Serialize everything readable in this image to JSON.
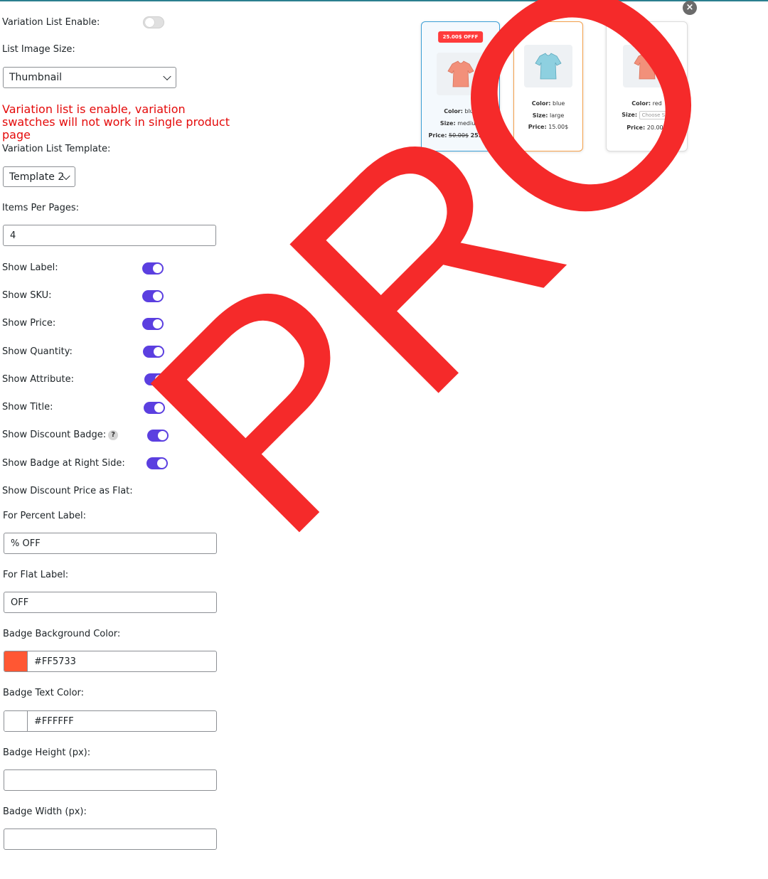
{
  "settings": {
    "variation_list_enable": "Variation List Enable:",
    "list_image_size": "List Image Size:",
    "list_image_size_value": "Thumbnail",
    "warning": "Variation list is enable, variation swatches will not work in single product page",
    "variation_list_template": "Variation List Template:",
    "template_value": "Template 2",
    "items_per_pages": "Items Per Pages:",
    "items_per_pages_value": "4",
    "show_label": "Show Label:",
    "show_sku": "Show SKU:",
    "show_price": "Show Price:",
    "show_quantity": "Show Quantity:",
    "show_attribute": "Show Attribute:",
    "show_title": "Show Title:",
    "show_discount_badge": "Show Discount Badge:",
    "help_mark": "?",
    "show_badge_right": "Show Badge at Right Side:",
    "show_discount_flat": "Show Discount Price as Flat:",
    "percent_label": "For Percent Label:",
    "percent_label_value": "% OFF",
    "flat_label": "For Flat Label:",
    "flat_label_value": "OFF",
    "badge_bg_color": "Badge Background Color:",
    "badge_bg_color_value": "#FF5733",
    "badge_text_color": "Badge Text Color:",
    "badge_text_color_value": "#FFFFFF",
    "badge_height": "Badge Height (px):",
    "badge_width": "Badge Width (px):"
  },
  "toggles": {
    "variation_list_enable": false,
    "show_label": true,
    "show_sku": true,
    "show_price": true,
    "show_quantity": true,
    "show_attribute": true,
    "show_title": true,
    "show_discount_badge": true,
    "show_badge_right": true
  },
  "watermark": "PRO",
  "preview": {
    "close": "×",
    "card1": {
      "badge": "25.00$ OFFF",
      "color_label": "Color:",
      "color": "blue",
      "size_label": "Size:",
      "size": "medium",
      "price_label": "Price:",
      "old_price": "50.00$",
      "price": "25.00$"
    },
    "card2": {
      "color_label": "Color:",
      "color": "blue",
      "size_label": "Size:",
      "size": "large",
      "price_label": "Price:",
      "price": "15.00$"
    },
    "card3": {
      "color_label": "Color:",
      "color": "red",
      "size_label": "Size:",
      "size_select": "Choose Siz",
      "price_label": "Price:",
      "price": "20.00$"
    }
  },
  "colors": {
    "accent": "#5b3fe0",
    "warning": "#e40a0a",
    "badge_bg": "#FF5733",
    "watermark": "#f52a2a",
    "card1_border": "#3b9fd6",
    "card2_border": "#f5a04a"
  }
}
